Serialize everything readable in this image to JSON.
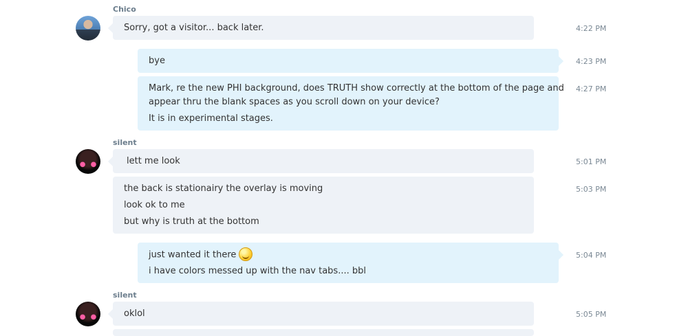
{
  "messages": [
    {
      "sender": "Chico",
      "text": "Sorry, got a visitor...  back later.",
      "time": "4:22 PM"
    },
    {
      "text": "bye",
      "time": "4:23 PM"
    },
    {
      "lines": [
        "Mark, re the new PHI background, does TRUTH show correctly at the bottom of the page and",
        "appear thru the blank spaces as you scroll down on your device?",
        "It is in experimental stages."
      ],
      "time": "4:27 PM"
    },
    {
      "sender": "silent",
      "text": "lett me look",
      "time": "5:01 PM"
    },
    {
      "lines": [
        "the back is stationairy the overlay is moving",
        "look ok to me",
        "but why is truth at the bottom"
      ],
      "time": "5:03 PM"
    },
    {
      "lines": [
        "just wanted it there",
        "i have colors messed up with the nav tabs.... bbl"
      ],
      "time": "5:04 PM",
      "emoji": "smile-emoji"
    },
    {
      "sender": "silent",
      "text": "oklol",
      "time": "5:05 PM"
    }
  ]
}
